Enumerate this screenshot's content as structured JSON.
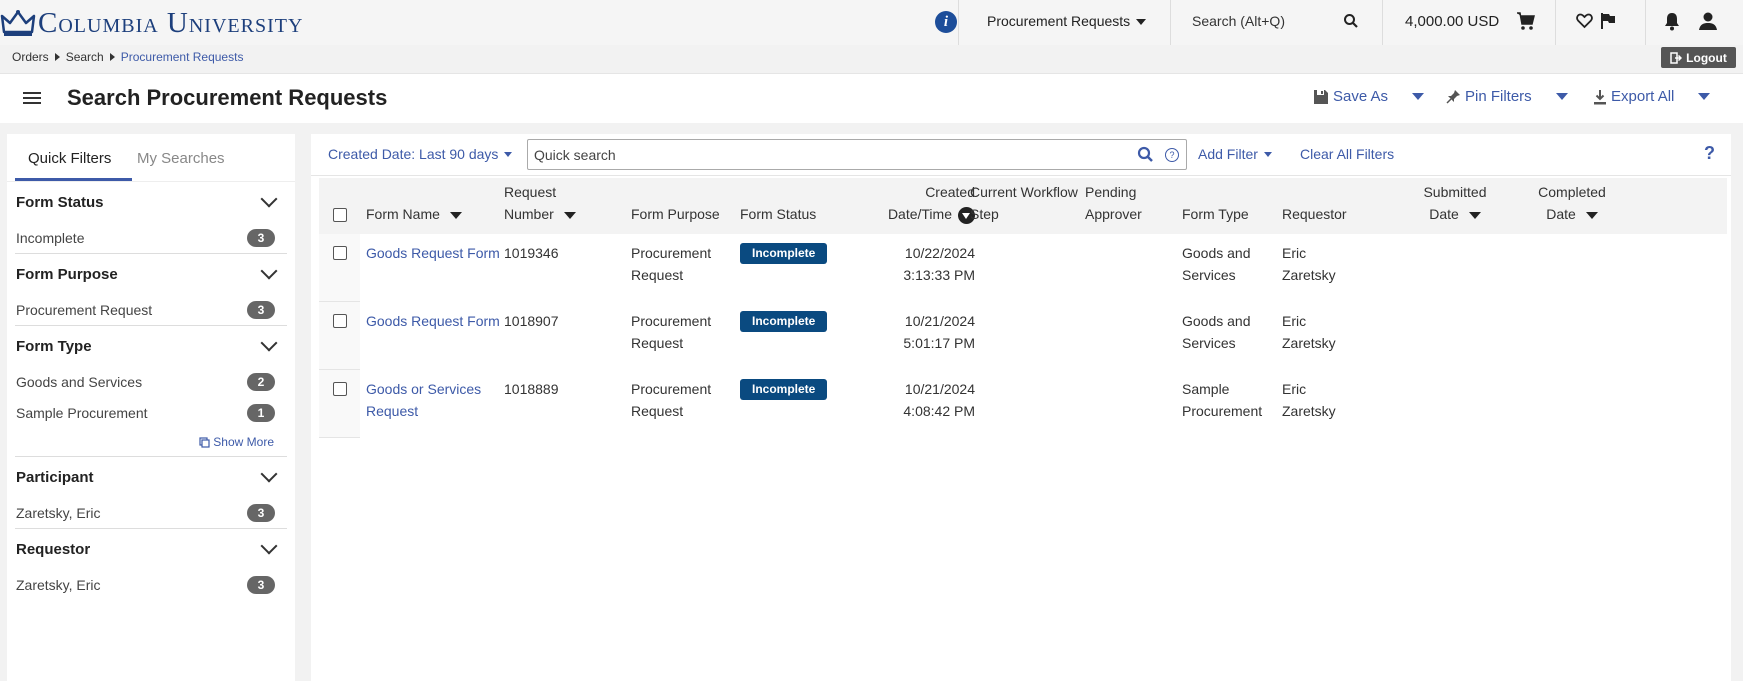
{
  "topbar": {
    "logo_text": "Columbia University",
    "logo_icon": "crown-icon",
    "info_label": "i",
    "module_dropdown": "Procurement Requests",
    "search_placeholder": "Search (Alt+Q)",
    "cart_amount": "4,000.00 USD",
    "icons": [
      "search-icon",
      "cart-icon",
      "heart-icon",
      "flag-icon",
      "bell-icon",
      "user-icon"
    ],
    "logout_label": "Logout"
  },
  "breadcrumb": [
    "Orders",
    "Search",
    "Procurement Requests"
  ],
  "header": {
    "title": "Search Procurement Requests",
    "save_as": "Save As",
    "pin_filters": "Pin Filters",
    "export_all": "Export All"
  },
  "sidebar": {
    "tabs": [
      "Quick Filters",
      "My Searches"
    ],
    "sections": [
      {
        "title": "Form Status",
        "items": [
          {
            "label": "Incomplete",
            "count": "3"
          }
        ]
      },
      {
        "title": "Form Purpose",
        "items": [
          {
            "label": "Procurement Request",
            "count": "3"
          }
        ]
      },
      {
        "title": "Form Type",
        "items": [
          {
            "label": "Goods and Services",
            "count": "2"
          },
          {
            "label": "Sample Procurement",
            "count": "1"
          }
        ],
        "show_more": "Show More"
      },
      {
        "title": "Participant",
        "items": [
          {
            "label": "Zaretsky, Eric",
            "count": "3"
          }
        ]
      },
      {
        "title": "Requestor",
        "items": [
          {
            "label": "Zaretsky, Eric",
            "count": "3"
          }
        ]
      }
    ]
  },
  "filters": {
    "date_filter": "Created Date: Last 90 days",
    "quick_search_placeholder": "Quick search",
    "add_filter": "Add Filter",
    "clear_all": "Clear All Filters",
    "help": "?"
  },
  "table": {
    "headers": {
      "form_name": "Form Name",
      "request_number_1": "Request",
      "request_number_2": "Number",
      "form_purpose": "Form Purpose",
      "form_status": "Form Status",
      "created_1": "Created",
      "created_2": "Date/Time",
      "workflow_1": "Current Workflow",
      "workflow_2": "Step",
      "pending_1": "Pending",
      "pending_2": "Approver",
      "form_type": "Form Type",
      "requestor": "Requestor",
      "submitted_1": "Submitted",
      "submitted_2": "Date",
      "completed_1": "Completed",
      "completed_2": "Date"
    },
    "rows": [
      {
        "form_name_1": "Goods Request Form",
        "form_name_2": "",
        "number": "1019346",
        "purpose_1": "Procurement",
        "purpose_2": "Request",
        "status": "Incomplete",
        "date": "10/22/2024",
        "time": "3:13:33 PM",
        "type_1": "Goods and",
        "type_2": "Services",
        "req_1": "Eric",
        "req_2": "Zaretsky"
      },
      {
        "form_name_1": "Goods Request Form",
        "form_name_2": "",
        "number": "1018907",
        "purpose_1": "Procurement",
        "purpose_2": "Request",
        "status": "Incomplete",
        "date": "10/21/2024",
        "time": "5:01:17 PM",
        "type_1": "Goods and",
        "type_2": "Services",
        "req_1": "Eric",
        "req_2": "Zaretsky"
      },
      {
        "form_name_1": "Goods or Services",
        "form_name_2": "Request",
        "number": "1018889",
        "purpose_1": "Procurement",
        "purpose_2": "Request",
        "status": "Incomplete",
        "date": "10/21/2024",
        "time": "4:08:42 PM",
        "type_1": "Sample",
        "type_2": "Procurement",
        "req_1": "Eric",
        "req_2": "Zaretsky"
      }
    ]
  },
  "colors": {
    "brand": "#1d3f7c",
    "link": "#3d5aa8",
    "status_badge": "#0a4a80"
  }
}
